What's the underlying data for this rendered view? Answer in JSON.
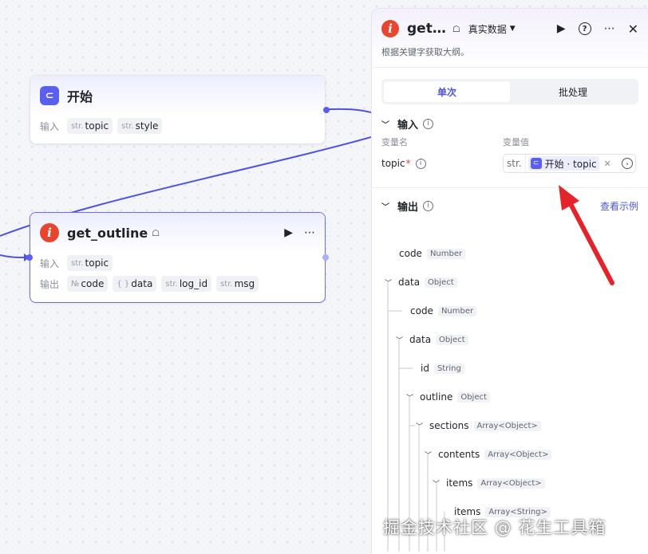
{
  "canvas": {
    "start_node": {
      "title": "开始",
      "input_label": "输入",
      "params": [
        {
          "type": "str.",
          "name": "topic"
        },
        {
          "type": "str.",
          "name": "style"
        }
      ]
    },
    "outline_node": {
      "title": "get_outline",
      "input_label": "输入",
      "output_label": "输出",
      "inputs": [
        {
          "type": "str.",
          "name": "topic"
        }
      ],
      "outputs": [
        {
          "type": "№",
          "name": "code"
        },
        {
          "type": "{ }",
          "name": "data"
        },
        {
          "type": "str.",
          "name": "log_id"
        },
        {
          "type": "str.",
          "name": "msg"
        }
      ]
    }
  },
  "panel": {
    "title": "get…",
    "mode": "真实数据",
    "description": "根据关键字获取大纲。",
    "tabs": [
      {
        "label": "单次",
        "active": true
      },
      {
        "label": "批处理",
        "active": false
      }
    ],
    "input_section": {
      "title": "输入",
      "col_name": "变量名",
      "col_value": "变量值",
      "var_name": "topic",
      "required_mark": "*",
      "value_type": "str.",
      "value_ref": "开始 · topic"
    },
    "output_section": {
      "title": "输出",
      "example_link": "查看示例",
      "tree": [
        {
          "name": "code",
          "type": "Number"
        },
        {
          "name": "data",
          "type": "Object"
        },
        {
          "name": "code",
          "type": "Number"
        },
        {
          "name": "data",
          "type": "Object"
        },
        {
          "name": "id",
          "type": "String"
        },
        {
          "name": "outline",
          "type": "Object"
        },
        {
          "name": "sections",
          "type": "Array<Object>"
        },
        {
          "name": "contents",
          "type": "Array<Object>"
        },
        {
          "name": "items",
          "type": "Array<Object>"
        },
        {
          "name": "items",
          "type": "Array<String>"
        }
      ]
    }
  },
  "watermark": "掘金技术社区 @ 花生工具箱",
  "colors": {
    "accent": "#5b5ff0",
    "plugin_icon": "#e8452e",
    "link": "#4e55d8",
    "annotation_arrow": "#e3242b"
  }
}
